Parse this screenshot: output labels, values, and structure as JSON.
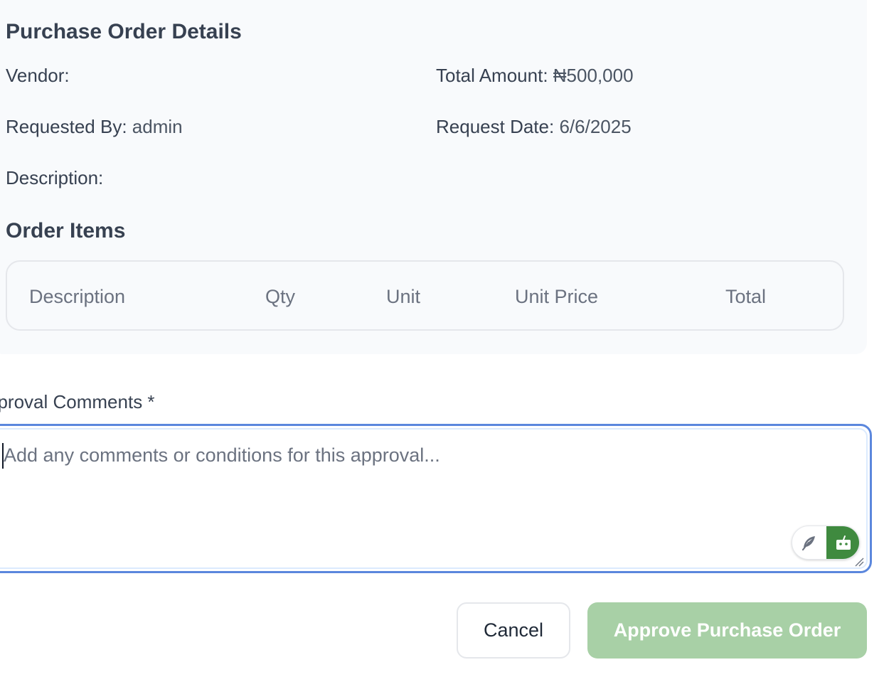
{
  "details": {
    "title": "Purchase Order Details",
    "vendor_label": "Vendor:",
    "vendor_value": "",
    "total_label": "Total Amount:",
    "total_value": "₦500,000",
    "requested_by_label": "Requested By:",
    "requested_by_value": "admin",
    "request_date_label": "Request Date:",
    "request_date_value": "6/6/2025",
    "description_label": "Description:",
    "description_value": ""
  },
  "order_items": {
    "title": "Order Items",
    "columns": [
      "Description",
      "Qty",
      "Unit",
      "Unit Price",
      "Total"
    ],
    "rows": []
  },
  "approval": {
    "label": "pproval Comments *",
    "placeholder": "Add any comments or conditions for this approval...",
    "value": "",
    "tool_icons": [
      "feather-icon",
      "robot-icon"
    ],
    "tool_accent": "#3f8a3f",
    "focus_color": "#5b87dd"
  },
  "actions": {
    "cancel_label": "Cancel",
    "approve_label": "Approve Purchase Order",
    "approve_color": "#a8d0a6"
  }
}
